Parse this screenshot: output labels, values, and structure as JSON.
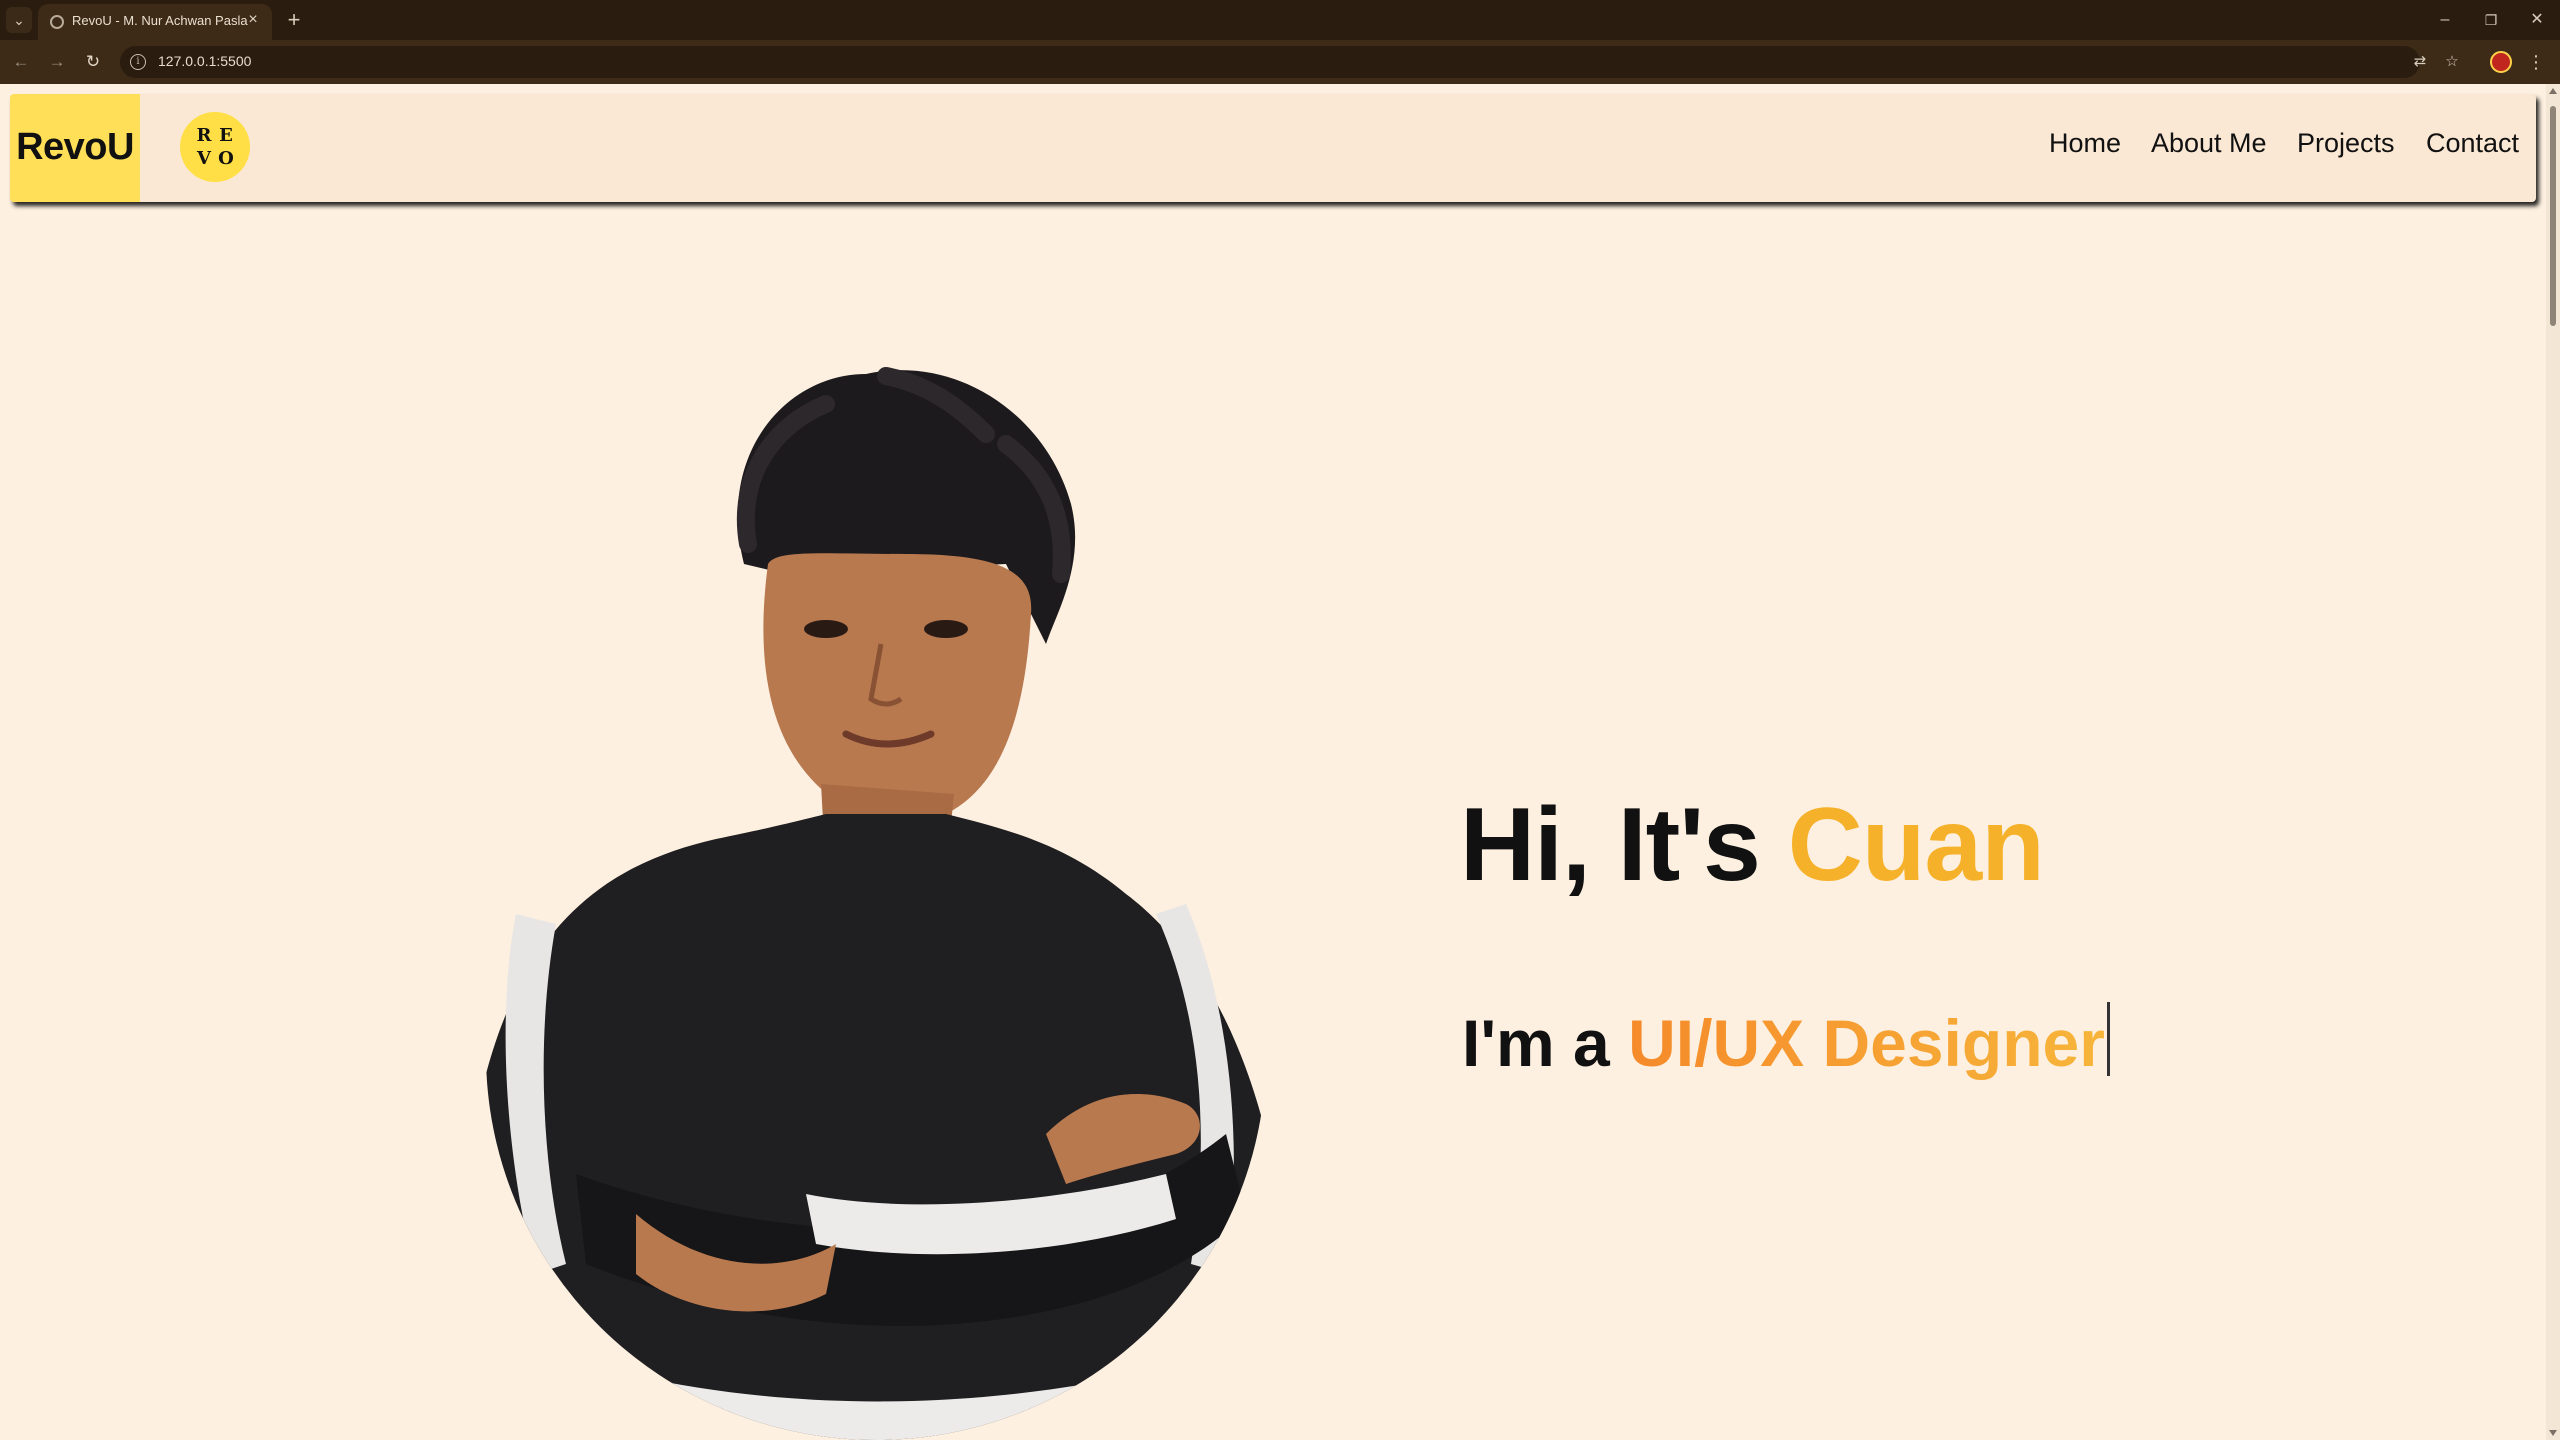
{
  "browser": {
    "tab_title": "RevoU - M. Nur Achwan Pasla",
    "url": "127.0.0.1:5500",
    "tab_menu_icon": "chevron-down-icon",
    "new_tab_icon": "plus-icon",
    "win_minimize": "–",
    "win_restore": "❐",
    "win_close": "✕"
  },
  "navbar": {
    "brand": "RevoU",
    "logo_letters": [
      "R",
      "E",
      "V",
      "O"
    ],
    "links": [
      "Home",
      "About Me",
      "Projects",
      "Contact"
    ]
  },
  "hero": {
    "greeting": "Hi, It's ",
    "name": "Cuan",
    "intro": "I'm a ",
    "role": "UI/UX Designer",
    "portrait_alt": "Portrait of Cuan"
  },
  "colors": {
    "page_background": "#fdf0e0",
    "navbar_background": "#fae8d4",
    "brand_yellow": "#ffdf57",
    "accent_orange": "#f6b12b",
    "browser_chrome": "#3d2b18"
  }
}
